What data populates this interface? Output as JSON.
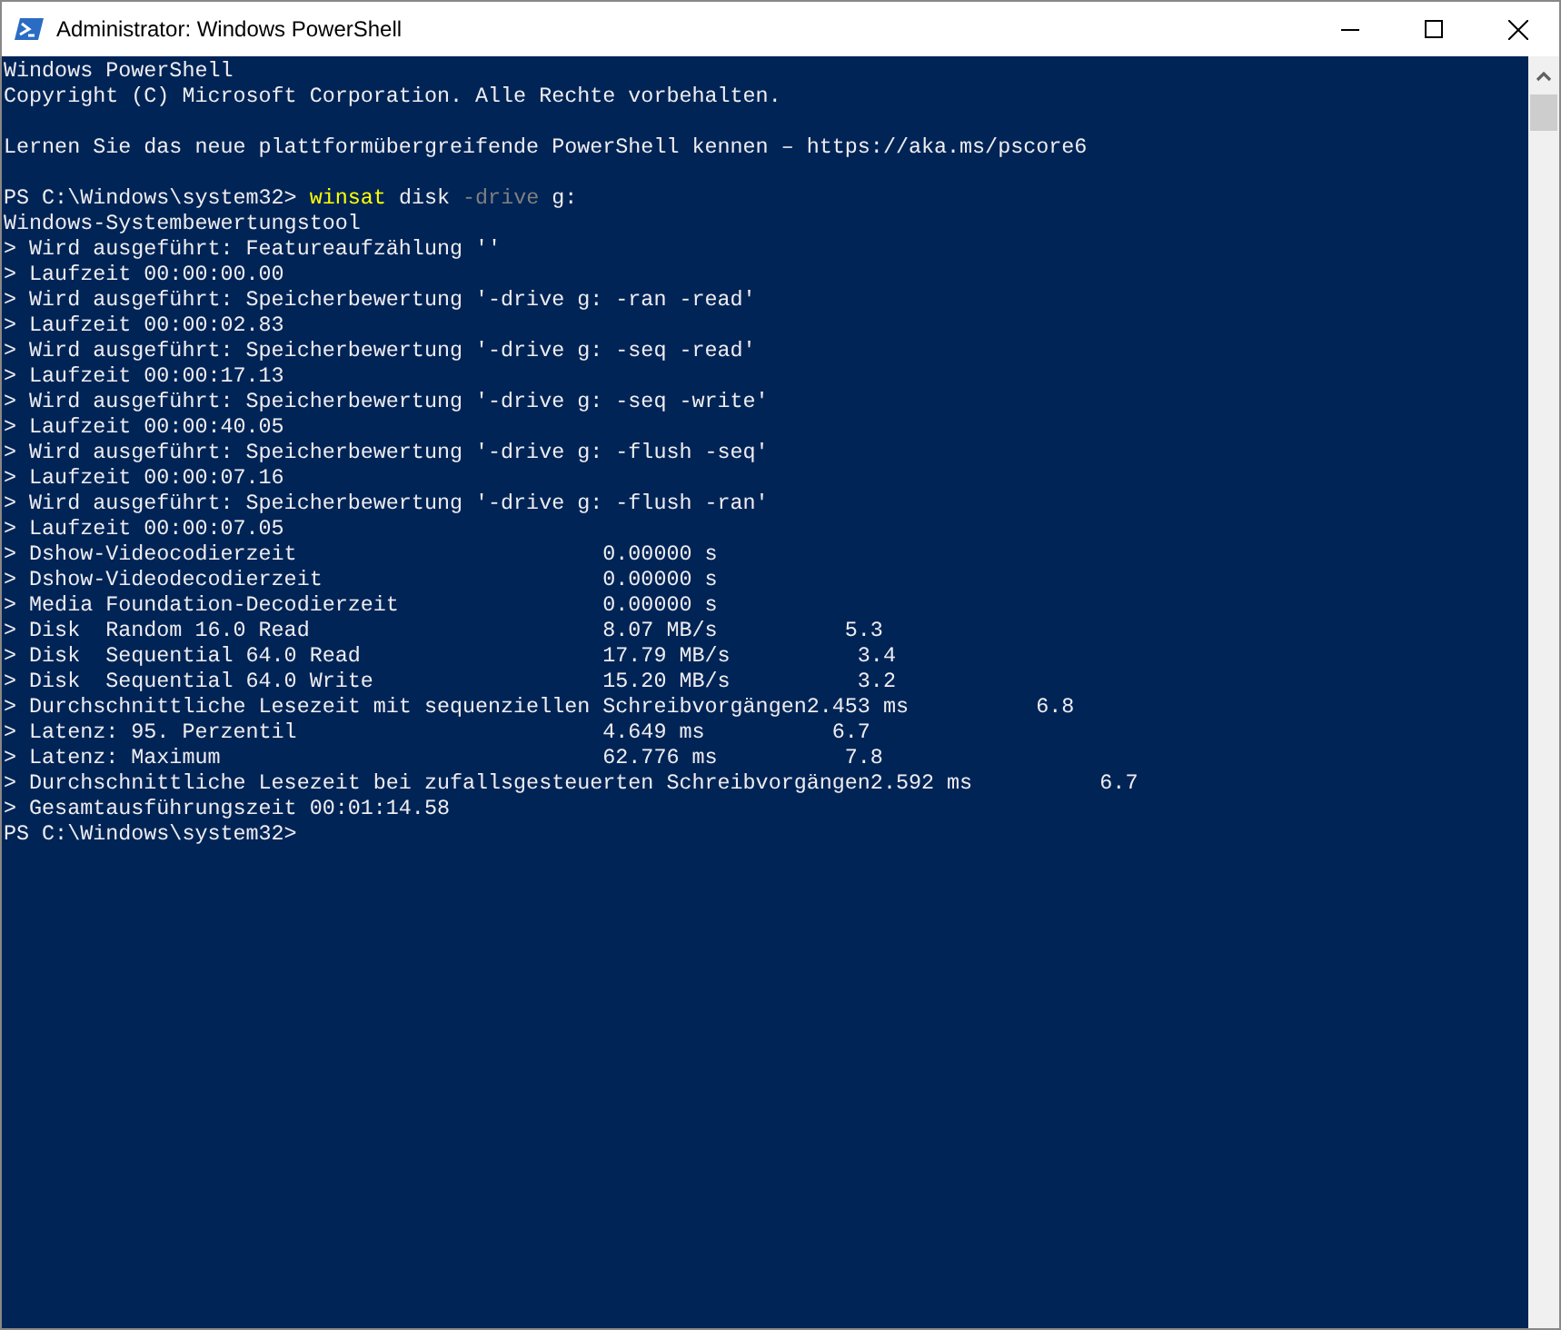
{
  "window": {
    "title": "Administrator: Windows PowerShell",
    "controls": [
      {
        "kind": "minimize"
      },
      {
        "kind": "maximize"
      },
      {
        "kind": "close"
      }
    ]
  },
  "console": {
    "lines": [
      {
        "kind": "text",
        "text": "Windows PowerShell"
      },
      {
        "kind": "text",
        "text": "Copyright (C) Microsoft Corporation. Alle Rechte vorbehalten."
      },
      {
        "kind": "blank"
      },
      {
        "kind": "text",
        "text": "Lernen Sie das neue plattformübergreifende PowerShell kennen – https://aka.ms/pscore6"
      },
      {
        "kind": "blank"
      },
      {
        "kind": "command",
        "prompt": "PS C:\\Windows\\system32>",
        "command": "winsat",
        "args": [
          {
            "kind": "argument",
            "text": "disk"
          },
          {
            "kind": "parameter",
            "text": "-drive"
          },
          {
            "kind": "argument",
            "text": "g:"
          }
        ]
      },
      {
        "kind": "text",
        "text": "Windows-Systembewertungstool"
      },
      {
        "kind": "text",
        "text": "> Wird ausgeführt: Featureaufzählung ''"
      },
      {
        "kind": "text",
        "text": "> Laufzeit 00:00:00.00"
      },
      {
        "kind": "text",
        "text": "> Wird ausgeführt: Speicherbewertung '-drive g: -ran -read'"
      },
      {
        "kind": "text",
        "text": "> Laufzeit 00:00:02.83"
      },
      {
        "kind": "text",
        "text": "> Wird ausgeführt: Speicherbewertung '-drive g: -seq -read'"
      },
      {
        "kind": "text",
        "text": "> Laufzeit 00:00:17.13"
      },
      {
        "kind": "text",
        "text": "> Wird ausgeführt: Speicherbewertung '-drive g: -seq -write'"
      },
      {
        "kind": "text",
        "text": "> Laufzeit 00:00:40.05"
      },
      {
        "kind": "text",
        "text": "> Wird ausgeführt: Speicherbewertung '-drive g: -flush -seq'"
      },
      {
        "kind": "text",
        "text": "> Laufzeit 00:00:07.16"
      },
      {
        "kind": "text",
        "text": "> Wird ausgeführt: Speicherbewertung '-drive g: -flush -ran'"
      },
      {
        "kind": "text",
        "text": "> Laufzeit 00:00:07.05"
      },
      {
        "kind": "text",
        "text": "> Dshow-Videocodierzeit                        0.00000 s"
      },
      {
        "kind": "text",
        "text": "> Dshow-Videodecodierzeit                      0.00000 s"
      },
      {
        "kind": "text",
        "text": "> Media Foundation-Decodierzeit                0.00000 s"
      },
      {
        "kind": "text",
        "text": "> Disk  Random 16.0 Read                       8.07 MB/s          5.3"
      },
      {
        "kind": "text",
        "text": "> Disk  Sequential 64.0 Read                   17.79 MB/s          3.4"
      },
      {
        "kind": "text",
        "text": "> Disk  Sequential 64.0 Write                  15.20 MB/s          3.2"
      },
      {
        "kind": "text",
        "text": "> Durchschnittliche Lesezeit mit sequenziellen Schreibvorgängen2.453 ms          6.8"
      },
      {
        "kind": "text",
        "text": "> Latenz: 95. Perzentil                        4.649 ms          6.7"
      },
      {
        "kind": "text",
        "text": "> Latenz: Maximum                              62.776 ms          7.8"
      },
      {
        "kind": "text",
        "text": "> Durchschnittliche Lesezeit bei zufallsgesteuerten Schreibvorgängen2.592 ms          6.7"
      },
      {
        "kind": "text",
        "text": "> Gesamtausführungszeit 00:01:14.58"
      },
      {
        "kind": "prompt",
        "prompt": "PS C:\\Windows\\system32>"
      }
    ]
  }
}
